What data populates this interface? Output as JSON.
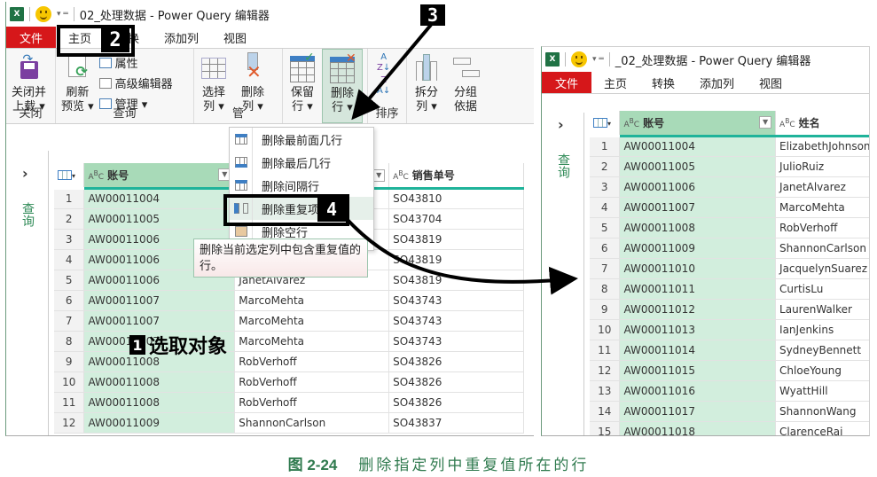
{
  "left_window": {
    "title": "02_处理数据 - Power Query 编辑器",
    "app_icon": "excel-icon",
    "menu": {
      "file": "文件",
      "items": [
        "主页",
        "转换",
        "添加列",
        "视图"
      ]
    },
    "ribbon": {
      "groups": [
        {
          "label": "关闭",
          "buttons": [
            {
              "label": "关闭并\n上载",
              "line1": "关闭并",
              "line2": "上载 ▾",
              "icon": "close-and-load-icon"
            }
          ]
        },
        {
          "label": "查询",
          "buttons": [
            {
              "line1": "刷新",
              "line2": "预览 ▾",
              "icon": "refresh-icon"
            }
          ],
          "small_buttons": [
            "属性",
            "高级编辑器",
            "管理 ▾"
          ]
        },
        {
          "label": "管",
          "buttons": [
            {
              "line1": "选择",
              "line2": "列 ▾",
              "icon": "choose-columns-icon"
            },
            {
              "line1": "删除",
              "line2": "列 ▾",
              "icon": "remove-columns-icon"
            }
          ]
        },
        {
          "label": "",
          "buttons": [
            {
              "line1": "保留",
              "line2": "行 ▾",
              "icon": "keep-rows-icon"
            },
            {
              "line1": "删除",
              "line2": "行 ▾",
              "icon": "remove-rows-icon",
              "active": true
            }
          ]
        },
        {
          "label": "排序",
          "buttons": [
            {
              "icon": "sort-icon"
            }
          ]
        },
        {
          "label": "",
          "buttons": [
            {
              "line1": "拆分",
              "line2": "列 ▾",
              "icon": "split-column-icon"
            },
            {
              "line1": "分组",
              "line2": "依据",
              "icon": "group-by-icon"
            }
          ]
        }
      ]
    },
    "dropdown": {
      "items": [
        "删除最前面几行",
        "删除最后几行",
        "删除间隔行",
        "删除重复项",
        "删除空行"
      ],
      "highlighted": "删除重复项"
    },
    "tooltip": "删除当前选定列中包含重复值的行。",
    "queries_label": "查询",
    "table": {
      "columns": [
        "账号",
        "",
        "销售单号"
      ],
      "rows": [
        {
          "n": "1",
          "acct": "AW00011004",
          "name": "",
          "so": "SO43810"
        },
        {
          "n": "2",
          "acct": "AW00011005",
          "name": "",
          "so": "SO43704"
        },
        {
          "n": "3",
          "acct": "AW00011006",
          "name": "",
          "so": "SO43819"
        },
        {
          "n": "4",
          "acct": "AW00011006",
          "name": "",
          "so": "SO43819"
        },
        {
          "n": "5",
          "acct": "AW00011006",
          "name": "JanetAlvarez",
          "so": "SO43819"
        },
        {
          "n": "6",
          "acct": "AW00011007",
          "name": "MarcoMehta",
          "so": "SO43743"
        },
        {
          "n": "7",
          "acct": "AW00011007",
          "name": "MarcoMehta",
          "so": "SO43743"
        },
        {
          "n": "8",
          "acct": "AW00011007",
          "name": "MarcoMehta",
          "so": "SO43743"
        },
        {
          "n": "9",
          "acct": "AW00011008",
          "name": "RobVerhoff",
          "so": "SO43826"
        },
        {
          "n": "10",
          "acct": "AW00011008",
          "name": "RobVerhoff",
          "so": "SO43826"
        },
        {
          "n": "11",
          "acct": "AW00011008",
          "name": "RobVerhoff",
          "so": "SO43826"
        },
        {
          "n": "12",
          "acct": "AW00011009",
          "name": "ShannonCarlson",
          "so": "SO43837"
        }
      ]
    }
  },
  "right_window": {
    "title": "_02_处理数据 - Power Query 编辑器",
    "menu": {
      "file": "文件",
      "items": [
        "主页",
        "转换",
        "添加列",
        "视图"
      ]
    },
    "queries_label": "查询",
    "table": {
      "columns": [
        "账号",
        "姓名"
      ],
      "rows": [
        {
          "n": "1",
          "acct": "AW00011004",
          "name": "ElizabethJohnson"
        },
        {
          "n": "2",
          "acct": "AW00011005",
          "name": "JulioRuiz"
        },
        {
          "n": "3",
          "acct": "AW00011006",
          "name": "JanetAlvarez"
        },
        {
          "n": "4",
          "acct": "AW00011007",
          "name": "MarcoMehta"
        },
        {
          "n": "5",
          "acct": "AW00011008",
          "name": "RobVerhoff"
        },
        {
          "n": "6",
          "acct": "AW00011009",
          "name": "ShannonCarlson"
        },
        {
          "n": "7",
          "acct": "AW00011010",
          "name": "JacquelynSuarez"
        },
        {
          "n": "8",
          "acct": "AW00011011",
          "name": "CurtisLu"
        },
        {
          "n": "9",
          "acct": "AW00011012",
          "name": "LaurenWalker"
        },
        {
          "n": "10",
          "acct": "AW00011013",
          "name": "IanJenkins"
        },
        {
          "n": "11",
          "acct": "AW00011014",
          "name": "SydneyBennett"
        },
        {
          "n": "12",
          "acct": "AW00011015",
          "name": "ChloeYoung"
        },
        {
          "n": "13",
          "acct": "AW00011016",
          "name": "WyattHill"
        },
        {
          "n": "14",
          "acct": "AW00011017",
          "name": "ShannonWang"
        },
        {
          "n": "15",
          "acct": "AW00011018",
          "name": "ClarenceRai"
        }
      ]
    }
  },
  "annotations": {
    "step1": {
      "num": "1",
      "text": "选取对象"
    },
    "step2": {
      "num": "2"
    },
    "step3": {
      "num": "3"
    },
    "step4": {
      "num": "4"
    }
  },
  "caption": {
    "figure": "图 2-24",
    "text": "删除指定列中重复值所在的行"
  },
  "colors": {
    "file_tab": "#d6171a",
    "selected_col_header": "#a8dab8",
    "selected_col_cells": "#d2eedd",
    "column_underline": "#1fb39a",
    "caption": "#2f7a4e"
  }
}
